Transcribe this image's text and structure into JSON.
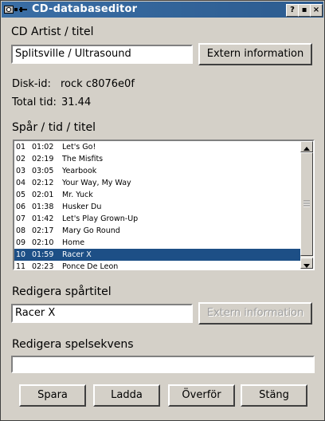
{
  "window": {
    "title": "CD-databaseditor",
    "controls": [
      "?",
      "▪",
      "×"
    ]
  },
  "artist": {
    "label": "CD Artist / titel",
    "value": "Splitsville / Ultrasound",
    "extern_button": "Extern information"
  },
  "disk": {
    "id_label": "Disk-id:",
    "id_value": "rock c8076e0f",
    "total_label": "Total tid:",
    "total_value": "31.44"
  },
  "tracks": {
    "label": "Spår / tid / titel",
    "items": [
      {
        "num": "01",
        "time": "01:02",
        "title": "Let's Go!"
      },
      {
        "num": "02",
        "time": "02:19",
        "title": "The Misfits"
      },
      {
        "num": "03",
        "time": "03:05",
        "title": "Yearbook"
      },
      {
        "num": "04",
        "time": "02:12",
        "title": "Your Way, My Way"
      },
      {
        "num": "05",
        "time": "02:01",
        "title": "Mr. Yuck"
      },
      {
        "num": "06",
        "time": "01:38",
        "title": "Husker Du"
      },
      {
        "num": "07",
        "time": "01:42",
        "title": "Let's Play Grown-Up"
      },
      {
        "num": "08",
        "time": "02:17",
        "title": "Mary Go Round"
      },
      {
        "num": "09",
        "time": "02:10",
        "title": "Home"
      },
      {
        "num": "10",
        "time": "01:59",
        "title": "Racer X"
      },
      {
        "num": "11",
        "time": "02:23",
        "title": "Ponce De Leon"
      }
    ],
    "selected_index": 9
  },
  "edit_track": {
    "label": "Redigera spårtitel",
    "value": "Racer X",
    "extern_button": "Extern information"
  },
  "edit_sequence": {
    "label": "Redigera spelsekvens",
    "value": ""
  },
  "buttons": {
    "save": "Spara",
    "load": "Ladda",
    "transfer": "Överför",
    "close": "Stäng"
  },
  "colors": {
    "title_bar": "#3a6ea5",
    "selection": "#1d4f86",
    "background": "#d4d0c8"
  }
}
